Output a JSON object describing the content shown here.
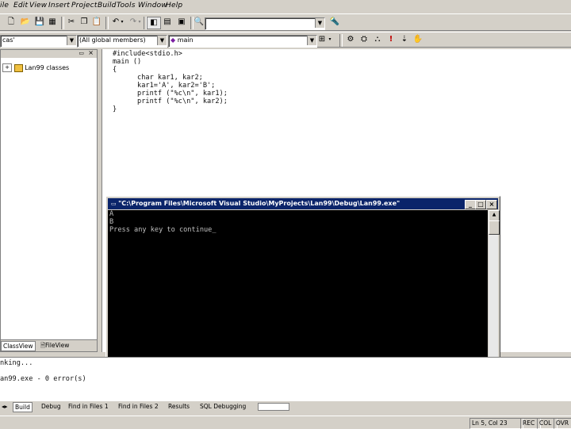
{
  "menu": [
    "ile",
    "Edit",
    "View",
    "Insert",
    "Project",
    "Build",
    "Tools",
    "Window",
    "Help"
  ],
  "toolbar": {
    "wizard_class_combo": "cas'",
    "wizard_members_combo": "(All global members)",
    "wizard_function_combo": "main"
  },
  "workspace": {
    "tree_root": "Lan99 classes",
    "tab_class_view": "ClassView",
    "tab_file_view": "FileView"
  },
  "editor": {
    "code": "#include<stdio.h>\nmain ()\n{\n      char kar1, kar2;\n      kar1='A', kar2='B';\n      printf (\"%c\\n\", kar1);\n      printf (\"%c\\n\", kar2);\n}"
  },
  "console": {
    "title": "\"C:\\Program Files\\Microsoft Visual Studio\\MyProjects\\Lan99\\Debug\\Lan99.exe\"",
    "output": "A\nB\nPress any key to continue_"
  },
  "output_panel": {
    "text": "nking...\n\nan99.exe - 0 error(s)"
  },
  "output_tabs": [
    "Build",
    "Debug",
    "Find in Files 1",
    "Find in Files 2",
    "Results",
    "SQL Debugging"
  ],
  "status": {
    "position": "Ln 5, Col 23",
    "rec": "REC",
    "col": "COL",
    "ovr": "OVR"
  }
}
